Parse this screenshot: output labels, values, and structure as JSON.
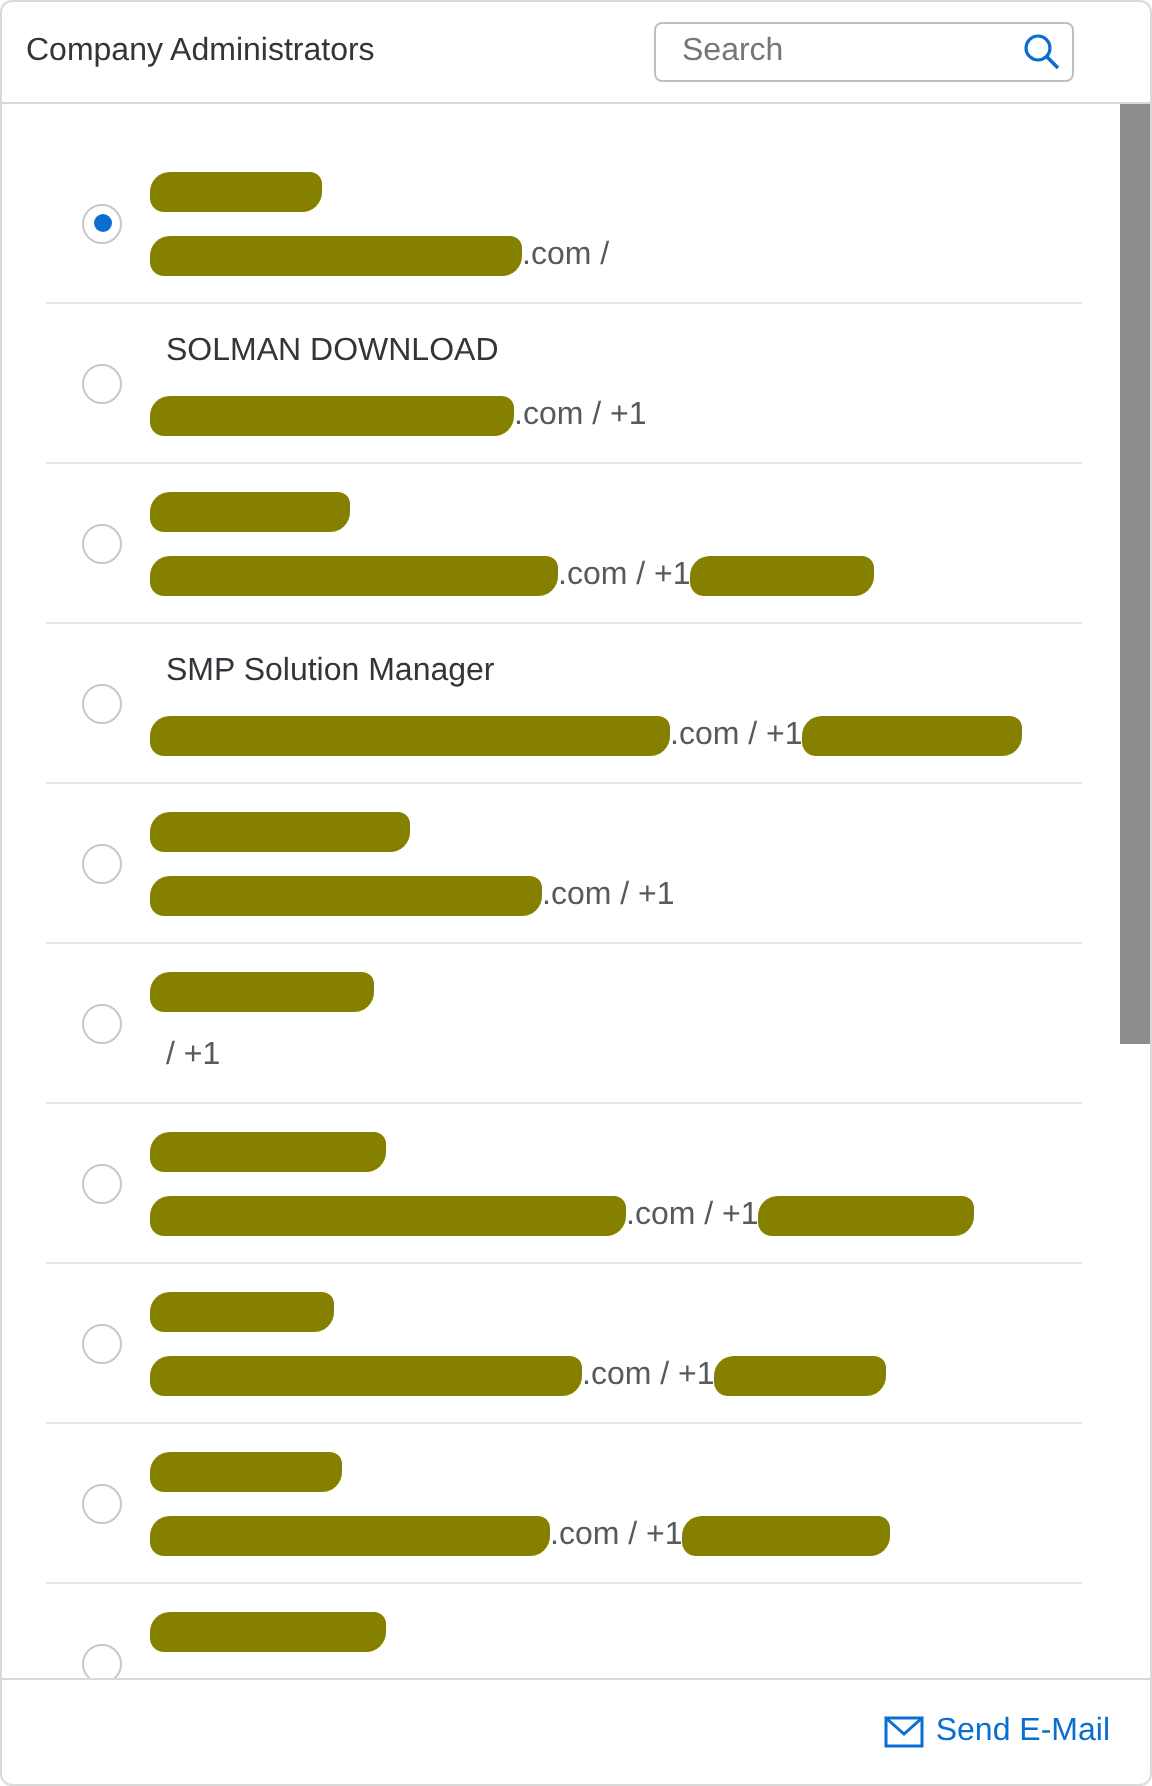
{
  "header": {
    "title": "Company Administrators",
    "search": {
      "placeholder": "Search"
    }
  },
  "administrators": [
    {
      "selected": true,
      "name_redacted": true,
      "contact": ".com /",
      "contact_redacted": true,
      "phone_redacted": false
    },
    {
      "selected": false,
      "name": "SOLMAN DOWNLOAD",
      "name_redacted": false,
      "contact": ".com / +1",
      "contact_redacted": true,
      "phone_redacted": false
    },
    {
      "selected": false,
      "name_redacted": true,
      "contact": ".com / +1",
      "contact_redacted": true,
      "phone_redacted": true
    },
    {
      "selected": false,
      "name": "SMP Solution Manager",
      "name_redacted": false,
      "contact": ".com / +1",
      "contact_redacted": true,
      "phone_redacted": true
    },
    {
      "selected": false,
      "name_redacted": true,
      "contact": ".com / +1",
      "contact_redacted": true,
      "phone_redacted": false
    },
    {
      "selected": false,
      "name_redacted": true,
      "contact": "/ +1",
      "contact_redacted": false,
      "phone_redacted": false
    },
    {
      "selected": false,
      "name_redacted": true,
      "contact": ".com / +1",
      "contact_redacted": true,
      "phone_redacted": true
    },
    {
      "selected": false,
      "name_redacted": true,
      "contact": ".com / +1",
      "contact_redacted": true,
      "phone_redacted": true
    },
    {
      "selected": false,
      "name_redacted": true,
      "contact": ".com / +1",
      "contact_redacted": true,
      "phone_redacted": true
    },
    {
      "selected": false,
      "name_redacted": true,
      "contact_redacted": false,
      "phone_redacted": false
    }
  ],
  "footer": {
    "send_button": "Send E-Mail"
  }
}
